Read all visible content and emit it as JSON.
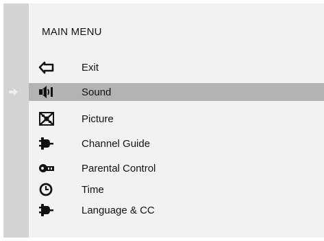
{
  "menu": {
    "title": "MAIN MENU",
    "selected_index": 1,
    "items": [
      {
        "label": "Exit",
        "icon": "exit-icon"
      },
      {
        "label": "Sound",
        "icon": "sound-icon"
      },
      {
        "label": "Picture",
        "icon": "picture-icon"
      },
      {
        "label": "Channel Guide",
        "icon": "plug-icon"
      },
      {
        "label": "Parental Control",
        "icon": "key-icon"
      },
      {
        "label": "Time",
        "icon": "clock-icon"
      },
      {
        "label": "Language & CC",
        "icon": "plug-icon"
      }
    ]
  },
  "colors": {
    "left_strip": "#d4d4d4",
    "panel_bg": "#f2f2f2",
    "selection_bg": "#b3b3b3",
    "text": "#111111"
  }
}
